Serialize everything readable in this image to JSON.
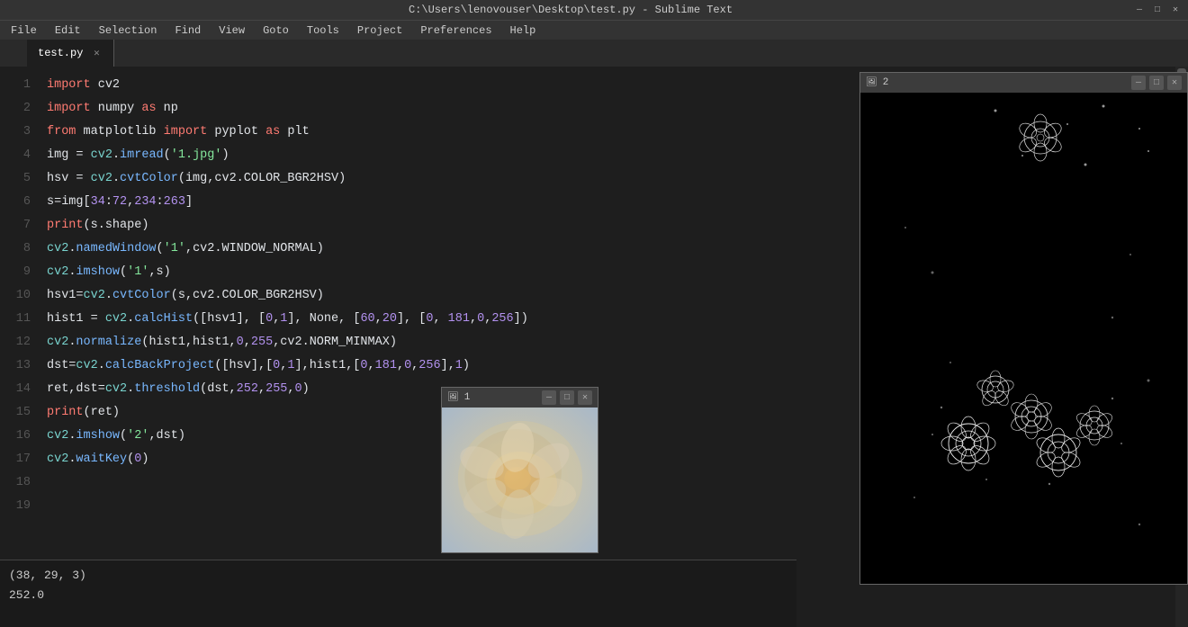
{
  "titlebar": {
    "title": "C:\\Users\\lenovouser\\Desktop\\test.py - Sublime Text",
    "min": "—",
    "max": "□",
    "close": "✕"
  },
  "menubar": {
    "items": [
      "File",
      "Edit",
      "Selection",
      "Find",
      "View",
      "Goto",
      "Tools",
      "Project",
      "Preferences",
      "Help"
    ]
  },
  "tabs": [
    {
      "label": "test.py",
      "active": true
    }
  ],
  "code": {
    "lines": [
      "1",
      "2",
      "3",
      "4",
      "5",
      "6",
      "7",
      "8",
      "9",
      "10",
      "11",
      "12",
      "13",
      "14",
      "15",
      "16",
      "17",
      "18",
      "19"
    ]
  },
  "console": {
    "line1": "(38, 29, 3)",
    "line2": "252.0"
  },
  "window1": {
    "title": "1",
    "min": "—",
    "max": "□",
    "close": "✕"
  },
  "window2": {
    "title": "2",
    "min": "—",
    "max": "□",
    "close": "✕"
  }
}
